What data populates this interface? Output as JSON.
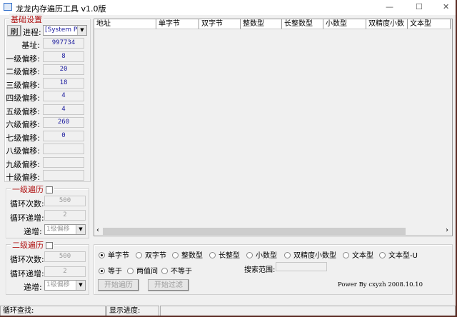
{
  "window": {
    "title": "龙龙内存遍历工具 v1.0版",
    "min": "—",
    "max": "☐",
    "close": "✕"
  },
  "basic": {
    "group_label": "基础设置",
    "refresh_label": "刷",
    "process_label": "进程:",
    "process_value": "[System Pr.",
    "rows": [
      {
        "label": "基址:",
        "value": "997734"
      },
      {
        "label": "一级偏移:",
        "value": "8"
      },
      {
        "label": "二级偏移:",
        "value": "20"
      },
      {
        "label": "三级偏移:",
        "value": "18"
      },
      {
        "label": "四级偏移:",
        "value": "4"
      },
      {
        "label": "五级偏移:",
        "value": "4"
      },
      {
        "label": "六级偏移:",
        "value": "260"
      },
      {
        "label": "七级偏移:",
        "value": "0"
      },
      {
        "label": "八级偏移:",
        "value": ""
      },
      {
        "label": "九级偏移:",
        "value": ""
      },
      {
        "label": "十级偏移:",
        "value": ""
      }
    ]
  },
  "loop1": {
    "group_label": "一级遍历",
    "count_label": "循环次数:",
    "count": "500",
    "inc_label": "循环递增:",
    "inc": "2",
    "step_label": "递增:",
    "step": "1级偏移"
  },
  "loop2": {
    "group_label": "二级遍历",
    "count_label": "循环次数:",
    "count": "500",
    "inc_label": "循环递增:",
    "inc": "2",
    "step_label": "递增:",
    "step": "1级偏移"
  },
  "table": {
    "columns": [
      "地址",
      "单字节",
      "双字节",
      "整数型",
      "长整数型",
      "小数型",
      "双精度小数",
      "文本型"
    ]
  },
  "search": {
    "types": [
      {
        "label": "单字节",
        "on": true
      },
      {
        "label": "双字节"
      },
      {
        "label": "整数型"
      },
      {
        "label": "长整型"
      },
      {
        "label": "小数型"
      },
      {
        "label": "双精度小数型"
      },
      {
        "label": "文本型"
      },
      {
        "label": "文本型-U"
      }
    ],
    "modes": [
      {
        "label": "等于",
        "on": true
      },
      {
        "label": "两值间"
      },
      {
        "label": "不等于"
      }
    ],
    "range_label": "搜索范围:",
    "range_value": "",
    "start_button": "开始遍历",
    "filter_button": "开始过滤",
    "credit": "Power By cxyzh 2008.10.10"
  },
  "status": {
    "loop_find": "循环查找:",
    "progress": "显示进度:"
  }
}
